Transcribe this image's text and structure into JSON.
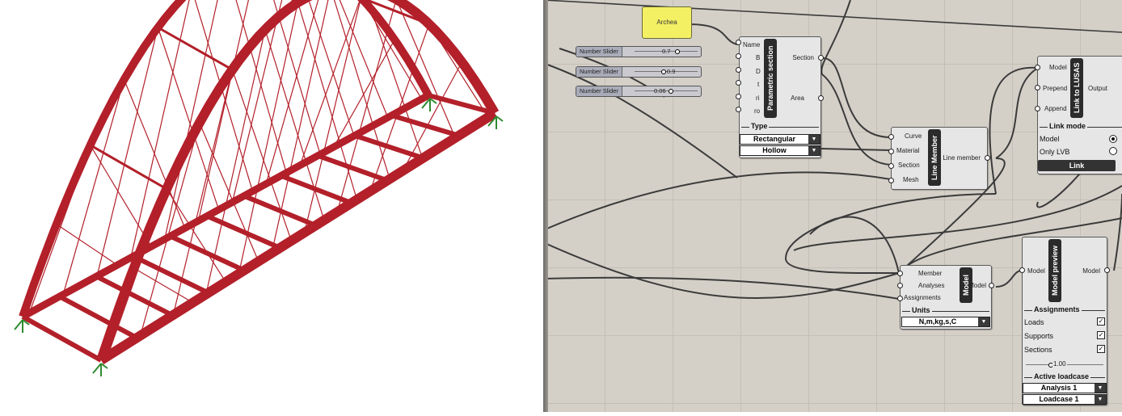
{
  "viewport": {
    "structure_color": "#b3202a",
    "support_color": "#2e8b2e"
  },
  "panel": {
    "text": "Archea"
  },
  "sliders": [
    {
      "label": "Number Slider",
      "value": "0.7"
    },
    {
      "label": "Number Slider",
      "value": "0.9"
    },
    {
      "label": "Number Slider",
      "value": "0.06"
    }
  ],
  "parametric_section": {
    "title": "Parametric section",
    "inputs": [
      "Name",
      "B",
      "D",
      "t",
      "ri",
      "ro"
    ],
    "outputs": [
      "Section",
      "Area"
    ],
    "type_label": "Type",
    "type_values": [
      "Rectangular",
      "Hollow"
    ]
  },
  "line_member": {
    "title": "Line Member",
    "inputs": [
      "Curve",
      "Material",
      "Section",
      "Mesh"
    ],
    "output": "Line member"
  },
  "link_usas": {
    "title": "Link to LUSAS",
    "inputs": [
      "Model",
      "Prepend",
      "Append"
    ],
    "output": "Output",
    "mode_label": "Link mode",
    "modes": [
      {
        "label": "Model",
        "selected": true
      },
      {
        "label": "Only LVB",
        "selected": false
      }
    ],
    "button": "Link"
  },
  "model": {
    "title": "Model",
    "inputs": [
      "Member",
      "Analyses",
      "Assignments"
    ],
    "output": "Model",
    "units_label": "Units",
    "units_value": "N,m,kg,s,C"
  },
  "model_preview": {
    "title": "Model preview",
    "input": "Model",
    "output": "Model",
    "assignments_label": "Assignments",
    "assignments": [
      {
        "label": "Loads",
        "checked": true
      },
      {
        "label": "Supports",
        "checked": true
      },
      {
        "label": "Sections",
        "checked": true
      }
    ],
    "scale_value": "1.00",
    "loadcase_label": "Active loadcase",
    "analysis_value": "Analysis 1",
    "loadcase_value": "Loadcase 1"
  }
}
